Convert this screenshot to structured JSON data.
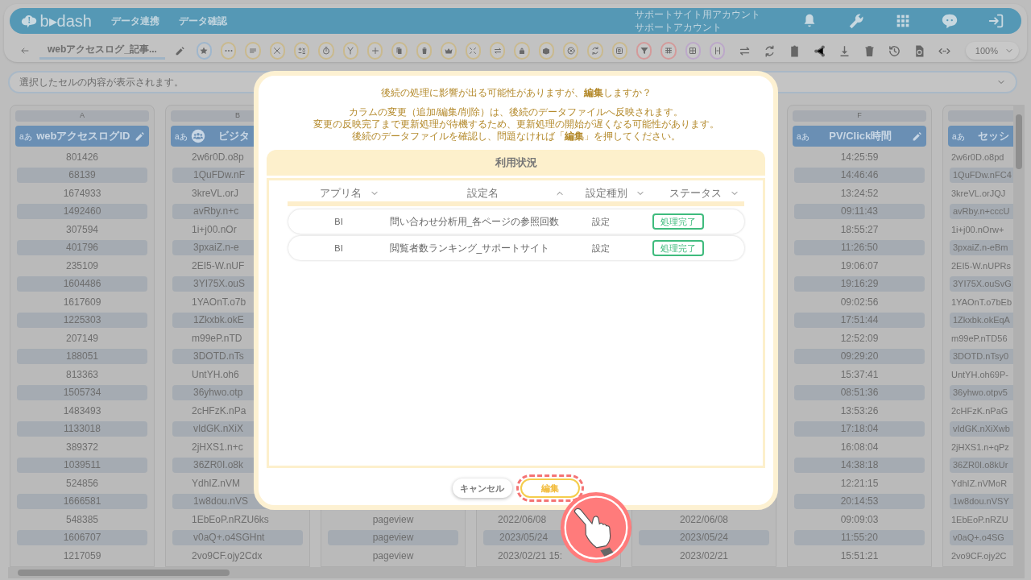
{
  "header": {
    "logo": "b▸dash",
    "nav": [
      {
        "label": "データ連携"
      },
      {
        "label": "データ確認"
      }
    ],
    "account": [
      "サポートサイト用アカウント",
      "サポートアカウント"
    ]
  },
  "toolbar": {
    "file_tab": "webアクセスログ_記事...",
    "zoom": "100%"
  },
  "formula_bar": {
    "placeholder": "選択したセルの内容が表示されます。"
  },
  "columns": [
    {
      "letter": "A",
      "type_label": "aあ",
      "header": "webアクセスログID",
      "kind": "full",
      "rows": [
        "801426",
        "68139",
        "1674933",
        "1492460",
        "307594",
        "401796",
        "235109",
        "1604486",
        "1617609",
        "1225303",
        "207149",
        "188051",
        "813363",
        "1505734",
        "1483493",
        "1133018",
        "389372",
        "1039511",
        "524856",
        "1666581",
        "548385",
        "1606707",
        "1217059"
      ]
    },
    {
      "letter": "B",
      "type_label": "aあ",
      "header": "ビジタ",
      "kind": "left",
      "rows": [
        "2w6r0D.o8p",
        "1QuFDw.nF",
        "3kreVL.orJ",
        "avRby.n+c",
        "1i+j00.nOr",
        "3pxaiZ.n-e",
        "2EI5-W.nUF",
        "3YI75X.ouS",
        "1YAOnT.o7b",
        "1Zkxbk.okE",
        "m99eP.nTD",
        "3DOTD.nTs",
        "UntYH.oh6",
        "36yhwo.otp",
        "2cHFzK.nPa",
        "vIdGK.nXiX",
        "2jHXS1.n+c",
        "36ZR0I.o8k",
        "YdhIZ.nVM",
        "1w8dou.nVS",
        "1EbEoP.nRZU6ks",
        "v0aQ+.o4SGHnt",
        "2vo9CF.ojy2Cdx"
      ]
    },
    {
      "kind": "hidden",
      "rows": [
        "pageview",
        "pageview",
        "pageview"
      ]
    },
    {
      "kind": "hidden",
      "rows": [
        "2022/06/08",
        "2023/05/24",
        "2023/02/21 15:"
      ]
    },
    {
      "kind": "hidden",
      "rows": [
        "2022/06/08",
        "2023/05/24",
        "2023/02/21"
      ]
    },
    {
      "letter": "F",
      "type_label": "aあ",
      "header": "PV/Click時間",
      "kind": "full",
      "rows": [
        "14:25:59",
        "14:46:46",
        "13:24:52",
        "09:11:43",
        "18:55:27",
        "11:26:50",
        "19:06:07",
        "19:16:29",
        "09:02:56",
        "17:51:44",
        "12:52:09",
        "09:29:20",
        "15:37:41",
        "08:51:36",
        "13:53:26",
        "17:18:04",
        "16:08:04",
        "14:38:18",
        "12:21:15",
        "20:14:53",
        "09:09:03",
        "11:55:20",
        "15:51:21"
      ]
    },
    {
      "type_label": "aあ",
      "header": "セッシ",
      "kind": "edge",
      "rows": [
        "2w6r0D.o8pd",
        "1QuFDw.nFC4",
        "3kreVL.orJQJ",
        "avRby.n+cccU",
        "1i+j00.nOrw+",
        "3pxaiZ.n-eBm",
        "2EI5-W.nUPRs",
        "3YI75X.ouSvG",
        "1YAOnT.o7bEb",
        "1Zkxbk.okEqA",
        "m99eP.nTD56",
        "3DOTD.nTsy0",
        "UntYH.oh69P-",
        "36yhwo.otpv5",
        "2cHFzK.nPaG",
        "vIdGK.nXiXwb",
        "2jHXS1.n+qPz",
        "36ZR0I.o8kUr",
        "YdhIZ.nVMoR",
        "1w8dou.nVSY",
        "1EbEoP.nRZU",
        "v0aQ+.o4SG",
        "2vo9CF.ojy2C"
      ]
    }
  ],
  "dialog": {
    "title": "後続の処理に影響が出る可能性がありますが、**編集**しますか？",
    "message": [
      "カラムの変更（追加/編集/削除）は、後続のデータファイルへ反映されます。",
      "変更の反映完了まで更新処理が待機するため、更新処理の開始が遅くなる可能性があります。",
      "後続のデータファイルを確認し、問題なければ「**編集**」を押してください。"
    ],
    "section": "利用状況",
    "table": {
      "columns": [
        {
          "label": "アプリ名",
          "ascending": false
        },
        {
          "label": "設定名",
          "ascending": true
        },
        {
          "label": "設定種別",
          "ascending": false
        },
        {
          "label": "ステータス",
          "ascending": false
        }
      ],
      "rows": [
        {
          "app": "BI",
          "name": "問い合わせ分析用_各ページの参照回数",
          "type": "設定",
          "status": "処理完了"
        },
        {
          "app": "BI",
          "name": "閲覧者数ランキング_サポートサイト",
          "type": "設定",
          "status": "処理完了"
        }
      ]
    },
    "buttons": [
      {
        "label": "キャンセル",
        "highlighted": false
      },
      {
        "label": "編集",
        "highlighted": true
      }
    ]
  }
}
